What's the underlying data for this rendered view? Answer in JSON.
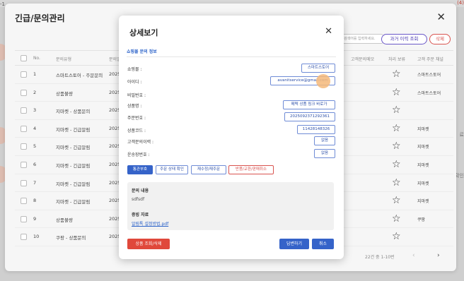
{
  "background": {
    "corner_left": "-1",
    "corner_right": "(4)",
    "side_text_1": "료",
    "side_text_2": "확인"
  },
  "list_panel": {
    "title": "긴급/문의관리",
    "close_icon": "close-icon",
    "search_placeholder": "검색어를 입력하세요.",
    "history_button": "과거 이력 조회",
    "delete_button": "삭제",
    "columns": {
      "no": "No.",
      "type": "문의유형",
      "date": "문의일",
      "customer_memo": "고객문의메모",
      "pending": "처리 보류",
      "channel": "고객 주문 채널"
    },
    "rows": [
      {
        "no": "1",
        "type": "스마트스토어 - 주문문의",
        "date": "2025-",
        "channel": "스마트스토어"
      },
      {
        "no": "2",
        "type": "상품불량",
        "date": "2025-",
        "channel": "스마트스토어"
      },
      {
        "no": "3",
        "type": "지마켓 - 상품문의",
        "date": "2025-",
        "channel": ""
      },
      {
        "no": "4",
        "type": "지마켓 - 긴급알림",
        "date": "2025-",
        "channel": "지마켓"
      },
      {
        "no": "5",
        "type": "지마켓 - 긴급알림",
        "date": "2025-",
        "channel": "지마켓"
      },
      {
        "no": "6",
        "type": "지마켓 - 긴급알림",
        "date": "2025-",
        "channel": "지마켓"
      },
      {
        "no": "7",
        "type": "지마켓 - 긴급알림",
        "date": "2025-",
        "channel": "지마켓"
      },
      {
        "no": "8",
        "type": "지마켓 - 긴급알림",
        "date": "2025-",
        "channel": "지마켓"
      },
      {
        "no": "9",
        "type": "상품불량",
        "date": "2025-",
        "channel": "쿠팡"
      },
      {
        "no": "10",
        "type": "쿠팡 - 상품문의",
        "date": "2025-",
        "channel": ""
      }
    ],
    "pagination": {
      "info": "22건 중 1-10번",
      "prev": "‹",
      "next": "›"
    }
  },
  "modal": {
    "title": "상세보기",
    "close_icon": "close-icon",
    "section": "쇼핑몰 문의 정보",
    "fields": [
      {
        "label": "쇼핑몰 :",
        "value": "스마트스토어"
      },
      {
        "label": "아이디 :",
        "value": "avanitservice@gmail.com"
      },
      {
        "label": "비밀번호 :",
        "value": ""
      },
      {
        "label": "상품명 :",
        "value": "메텍 상품 링크 바로가"
      },
      {
        "label": "주문번호 :",
        "value": "2025092371292361"
      },
      {
        "label": "상품코드 :",
        "value": "11428148326"
      },
      {
        "label": "고객문의이력 :",
        "value": "없음"
      },
      {
        "label": "운송장번호 :",
        "value": ""
      }
    ],
    "empty_value": "없음",
    "actions": {
      "primary": "통관부호",
      "order_status": "주문 상태 확인",
      "reorder": "재수정/재주문",
      "return": "반품/교환/판매취소"
    },
    "inquiry": {
      "title": "문의 내용",
      "body": "sdfsdf",
      "evidence_title": "증빙 자료",
      "evidence_link": "알림톡 설정방법.pdf"
    },
    "buttons": {
      "lookup_delete": "상품 조회/삭제",
      "reply": "답변하기",
      "cancel": "취소"
    }
  }
}
